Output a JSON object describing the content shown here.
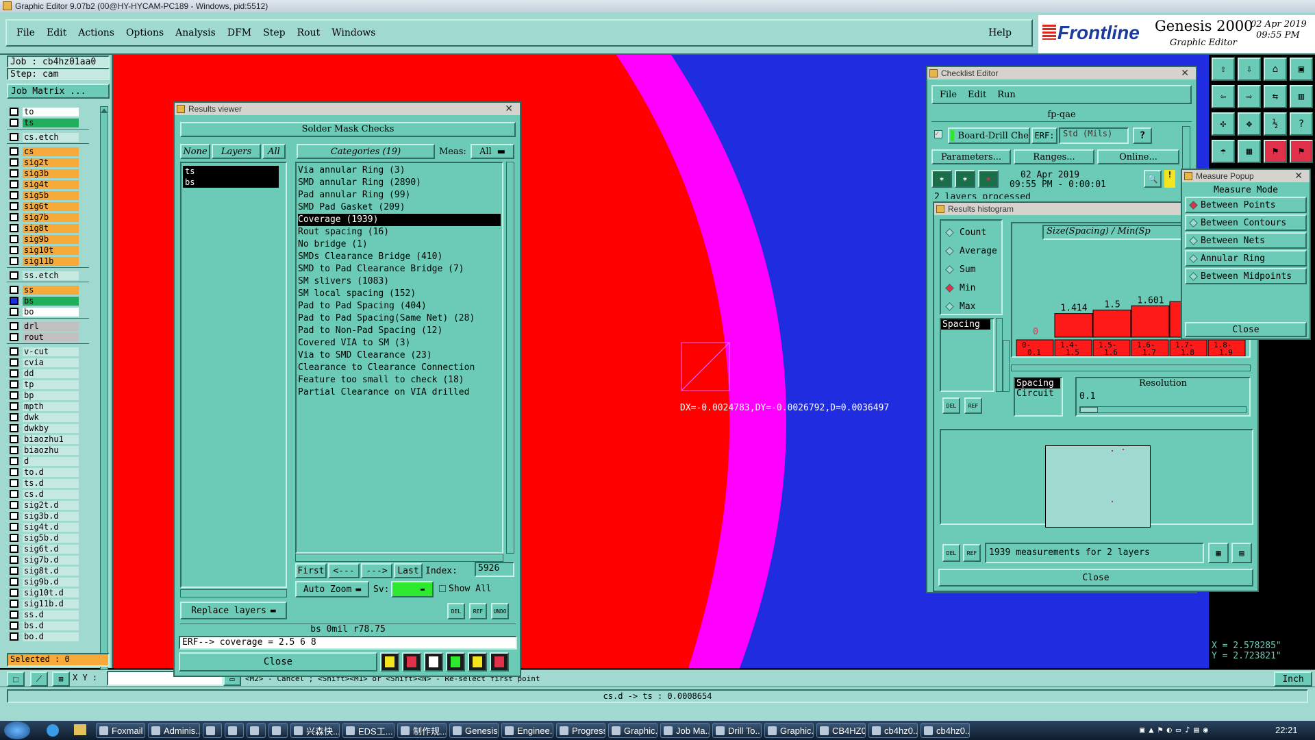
{
  "window_title": "Graphic Editor 9.07b2 (00@HY-HYCAM-PC189 - Windows, pid:5512)",
  "menubar": {
    "items": [
      "File",
      "Edit",
      "Actions",
      "Options",
      "Analysis",
      "DFM",
      "Step",
      "Rout",
      "Windows"
    ],
    "help": "Help"
  },
  "brand": {
    "logo": "Frontline",
    "product": "Genesis 2000",
    "subtitle": "Graphic Editor",
    "date": "02 Apr 2019",
    "time": "09:55 PM"
  },
  "job": {
    "job_label": "Job : cb4hz01aa0",
    "step_label": "Step: cam",
    "matrix_button": "Job Matrix ..."
  },
  "layers": [
    {
      "name": "to",
      "color": "#ffffff",
      "boxed": true
    },
    {
      "name": "ts",
      "color": "#1fae5a"
    },
    {
      "sep": true
    },
    {
      "name": "cs.etch",
      "color": "#c5e8e0"
    },
    {
      "sep": true
    },
    {
      "name": "cs",
      "color": "#f7a93a"
    },
    {
      "name": "sig2t",
      "color": "#f7a93a"
    },
    {
      "name": "sig3b",
      "color": "#f7a93a"
    },
    {
      "name": "sig4t",
      "color": "#f7a93a"
    },
    {
      "name": "sig5b",
      "color": "#f7a93a"
    },
    {
      "name": "sig6t",
      "color": "#f7a93a"
    },
    {
      "name": "sig7b",
      "color": "#f7a93a"
    },
    {
      "name": "sig8t",
      "color": "#f7a93a"
    },
    {
      "name": "sig9b",
      "color": "#f7a93a"
    },
    {
      "name": "sig10t",
      "color": "#f7a93a"
    },
    {
      "name": "sig11b",
      "color": "#f7a93a"
    },
    {
      "sep": true
    },
    {
      "name": "ss.etch",
      "color": "#c5e8e0"
    },
    {
      "sep": true
    },
    {
      "name": "ss",
      "color": "#f7a93a"
    },
    {
      "name": "bs",
      "color": "#1fae5a",
      "selected": true
    },
    {
      "name": "bo",
      "color": "#ffffff",
      "boxed": true
    },
    {
      "sep": true
    },
    {
      "name": "drl",
      "color": "#c0c0c0"
    },
    {
      "name": "rout",
      "color": "#c0c0c0"
    },
    {
      "sep": true
    },
    {
      "name": "v-cut",
      "color": "#c5e8e0"
    },
    {
      "name": "cvia",
      "color": "#c5e8e0"
    },
    {
      "name": "dd",
      "color": "#c5e8e0"
    },
    {
      "name": "tp",
      "color": "#c5e8e0"
    },
    {
      "name": "bp",
      "color": "#c5e8e0"
    },
    {
      "name": "mpth",
      "color": "#c5e8e0"
    },
    {
      "name": "dwk",
      "color": "#c5e8e0"
    },
    {
      "name": "dwkby",
      "color": "#c5e8e0"
    },
    {
      "name": "biaozhu1",
      "color": "#c5e8e0"
    },
    {
      "name": "biaozhu",
      "color": "#c5e8e0"
    },
    {
      "name": "d",
      "color": "#c5e8e0"
    },
    {
      "name": "to.d",
      "color": "#c5e8e0"
    },
    {
      "name": "ts.d",
      "color": "#c5e8e0"
    },
    {
      "name": "cs.d",
      "color": "#c5e8e0"
    },
    {
      "name": "sig2t.d",
      "color": "#c5e8e0"
    },
    {
      "name": "sig3b.d",
      "color": "#c5e8e0"
    },
    {
      "name": "sig4t.d",
      "color": "#c5e8e0"
    },
    {
      "name": "sig5b.d",
      "color": "#c5e8e0"
    },
    {
      "name": "sig6t.d",
      "color": "#c5e8e0"
    },
    {
      "name": "sig7b.d",
      "color": "#c5e8e0"
    },
    {
      "name": "sig8t.d",
      "color": "#c5e8e0"
    },
    {
      "name": "sig9b.d",
      "color": "#c5e8e0"
    },
    {
      "name": "sig10t.d",
      "color": "#c5e8e0"
    },
    {
      "name": "sig11b.d",
      "color": "#c5e8e0"
    },
    {
      "name": "ss.d",
      "color": "#c5e8e0"
    },
    {
      "name": "bs.d",
      "color": "#c5e8e0"
    },
    {
      "name": "bo.d",
      "color": "#c5e8e0"
    }
  ],
  "selected_label": "Selected : 0",
  "xy_label": "X Y :",
  "prompt_line": "<M2> - Cancel ; <Shift><M1> or <Shift><N> - Re-select first point",
  "status_line": "cs.d -> ts : 0.0008654",
  "units_button": "Inch",
  "coords": {
    "x": "X = 2.578285\"",
    "y": "Y = 2.723821\""
  },
  "measure_readout": "DX=-0.0024783,DY=-0.0026792,D=0.0036497",
  "results_viewer": {
    "title": "Results viewer",
    "header": "Solder Mask Checks",
    "none_btn": "None",
    "layers_btn": "Layers",
    "all_btn": "All",
    "categories_btn": "Categories (19)",
    "meas_label": "Meas:",
    "meas_value": "All",
    "layer_list": [
      "ts",
      "bs"
    ],
    "categories": [
      "Via annular Ring (3)",
      "SMD annular Ring (2890)",
      "Pad annular Ring (99)",
      "SMD Pad Gasket (209)",
      "Coverage (1939)",
      "Rout spacing (16)",
      "No bridge (1)",
      "SMDs Clearance Bridge (410)",
      "SMD to Pad Clearance Bridge (7)",
      "SM slivers (1083)",
      "SM local spacing (152)",
      "Pad to Pad Spacing (404)",
      "Pad to Pad Spacing(Same Net) (28)",
      "Pad to Non-Pad Spacing (12)",
      "Covered VIA to SM (3)",
      "Via to SMD Clearance (23)",
      "Clearance to Clearance Connection",
      "Feature too small to check (18)",
      "Partial Clearance on VIA drilled"
    ],
    "selected_index": 4,
    "nav": {
      "first": "First",
      "prev": "<---",
      "next": "--->",
      "last": "Last",
      "index_label": "Index:",
      "index_value": "5926"
    },
    "auto_zoom": "Auto Zoom",
    "sv_label": "Sv:",
    "show_all": "Show All",
    "replace_layers": "Replace layers",
    "info": "bs 0mil   r78.75",
    "erf_line": "ERF--> coverage = 2.5 6 8",
    "close": "Close"
  },
  "checklist_editor": {
    "title": "Checklist Editor",
    "menu": [
      "File",
      "Edit",
      "Run"
    ],
    "checklist_name": "fp-qae",
    "action_name": "Board-Drill Che",
    "erf_label": "ERF:",
    "erf_value": "Std (Mils)",
    "help_btn": "?",
    "params_btn": "Parameters...",
    "ranges_btn": "Ranges...",
    "online_btn": "Online...",
    "date": "02 Apr 2019",
    "time_range": "09:55 PM - 0:00:01",
    "processed": "2 layers processed"
  },
  "histogram": {
    "title": "Results histogram",
    "modes": [
      "Count",
      "Average",
      "Sum",
      "Min",
      "Max"
    ],
    "selected_mode": "Min",
    "list_item": "Spacing",
    "chart_title": "Size(Spacing) / Min(Sp",
    "resolution_label": "Resolution",
    "resolution_value": "0.1",
    "type_items": [
      "Spacing",
      "Circuit"
    ],
    "measurements": "1939 measurements for 2 layers",
    "close": "Close",
    "del_label": "DEL",
    "ref_label": "REF"
  },
  "chart_data": {
    "type": "bar",
    "title": "Size(Spacing) / Min(Sp",
    "categories": [
      "0-0.1",
      "1.4-1.5",
      "1.5-1.6",
      "1.6-1.7",
      "1.7-1.8",
      "1.8-1.9"
    ],
    "values": [
      0,
      1.414,
      1.5,
      1.601,
      1.7,
      1.8
    ],
    "value_labels": [
      "0",
      "1.414",
      "1.5",
      "1.601",
      "",
      ""
    ],
    "bar_color": "#ff1a1a"
  },
  "measure_popup": {
    "title": "Measure Popup",
    "header": "Measure Mode",
    "options": [
      "Between Points",
      "Between Contours",
      "Between Nets",
      "Annular Ring",
      "Between Midpoints"
    ],
    "selected": "Between Points",
    "close": "Close"
  },
  "taskbar": {
    "items": [
      "Foxmail",
      "Adminis...",
      "",
      "",
      "",
      "",
      "兴森快...",
      "EDS工...",
      "制作规...",
      "Genesis",
      "Enginee...",
      "Progress",
      "Graphic...",
      "Job Ma...",
      "Drill To...",
      "Graphic...",
      "CB4HZ0...",
      "cb4hz0...",
      "cb4hz0..."
    ],
    "clock": "22:21"
  }
}
